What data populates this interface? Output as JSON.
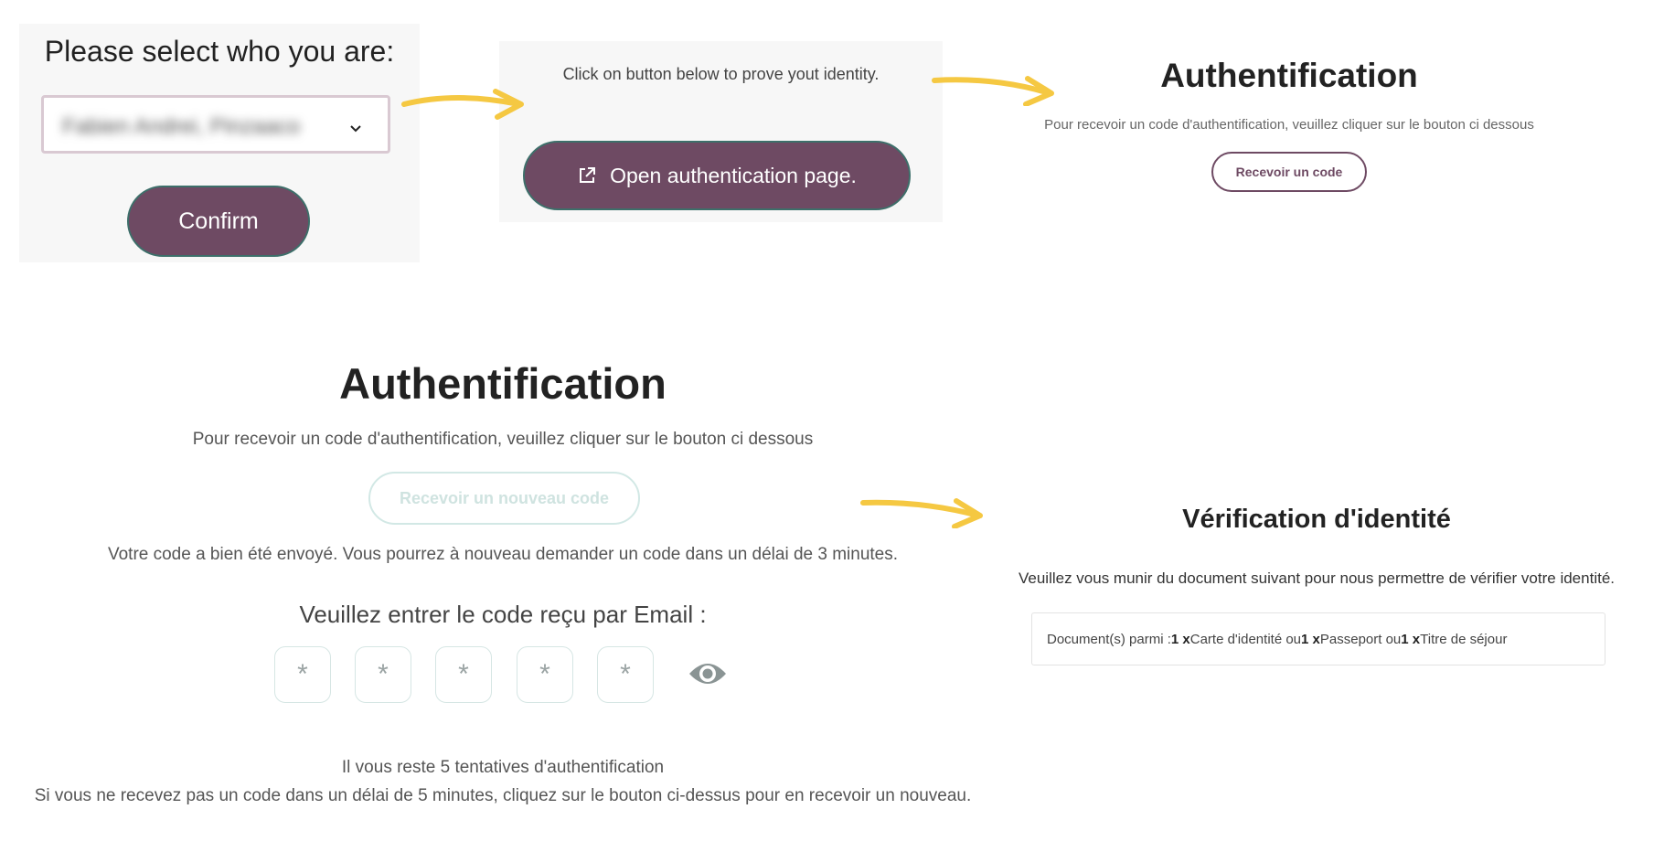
{
  "colors": {
    "brand": "#6e4a63",
    "button_border": "#3d6f6a",
    "arrow": "#f5c842",
    "disabled": "#cfe3e0"
  },
  "step1": {
    "title": "Please select who you are:",
    "selected_value": "Fabien Andrei, Pinzaaco",
    "confirm_label": "Confirm"
  },
  "step2": {
    "instruction": "Click on button below to prove yout identity.",
    "open_auth_label": "Open authentication page."
  },
  "step3": {
    "title": "Authentification",
    "description": "Pour recevoir un code d'authentification, veuillez cliquer sur le bouton ci dessous",
    "receive_label": "Recevoir un code"
  },
  "step4": {
    "title": "Authentification",
    "description": "Pour recevoir un code d'authentification, veuillez cliquer sur le bouton ci dessous",
    "new_code_label": "Recevoir un nouveau code",
    "sent_message": "Votre code a bien été envoyé. Vous pourrez à nouveau demander un code dans un délai de 3 minutes.",
    "enter_code_label": "Veuillez entrer le code reçu par Email :",
    "code_digits": [
      "*",
      "*",
      "*",
      "*",
      "*"
    ],
    "attempts_text": "Il vous reste 5 tentatives d'authentification",
    "resend_hint": "Si vous ne recevez pas un code dans un délai de 5 minutes, cliquez sur le bouton ci-dessus pour en recevoir un nouveau."
  },
  "step5": {
    "title": "Vérification d'identité",
    "description": "Veuillez vous munir du document suivant pour nous permettre de vérifier votre identité.",
    "doc_prefix": "Document(s) parmi : ",
    "doc_q1": "1 x",
    "doc_item1": " Carte d'identité ou ",
    "doc_q2": "1 x",
    "doc_item2": " Passeport ou ",
    "doc_q3": "1 x",
    "doc_item3": " Titre de séjour"
  },
  "icons": {
    "chevron": "chevron-down-icon",
    "external": "external-link-icon",
    "eye": "eye-icon",
    "arrow": "arrow-right-icon"
  }
}
